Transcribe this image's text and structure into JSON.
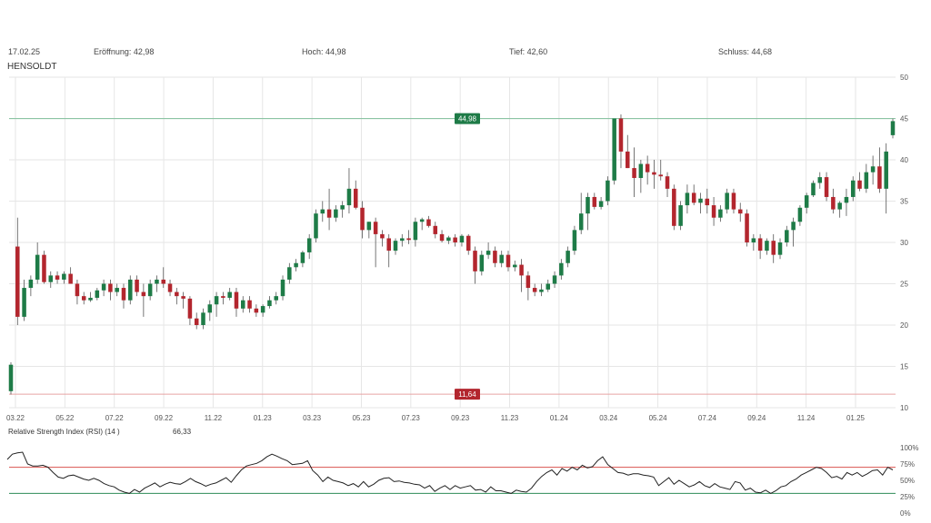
{
  "header": {
    "date": "17.02.25",
    "open_label": "Eröffnung: 42,98",
    "high_label": "Hoch: 44,98",
    "low_label": "Tief: 42,60",
    "close_label": "Schluss: 44,68",
    "symbol": "HENSOLDT"
  },
  "rsi": {
    "label": "Relative Strength Index (RSI) (14 )",
    "current": "66,33"
  },
  "colors": {
    "up": "#1e7b47",
    "down": "#b3262e",
    "grid": "#e6e6e6",
    "rsi_line": "#222222",
    "rsi_upper": "#d9534f",
    "rsi_lower": "#2e8b57"
  },
  "chart_data": [
    {
      "type": "candlestick",
      "title": "HENSOLDT",
      "ylim": [
        10,
        50
      ],
      "y_ticks": [
        "10",
        "15",
        "20",
        "25",
        "30",
        "35",
        "40",
        "45",
        "50"
      ],
      "x_ticks": [
        "03.22",
        "05.22",
        "07.22",
        "09.22",
        "11.22",
        "01.23",
        "03.23",
        "05.23",
        "07.23",
        "09.23",
        "11.23",
        "01.24",
        "03.24",
        "05.24",
        "07.24",
        "09.24",
        "11.24",
        "01.25"
      ],
      "grid": true,
      "max_marker": {
        "label": "44,98",
        "value": 44.98
      },
      "min_marker": {
        "label": "11,64",
        "value": 11.64
      },
      "candles": [
        [
          12,
          15.5,
          11.6,
          15.2
        ],
        [
          29.5,
          33,
          20,
          21
        ],
        [
          21,
          25.5,
          20.5,
          24.5
        ],
        [
          24.5,
          26,
          23.5,
          25.5
        ],
        [
          25.5,
          30,
          25,
          28.5
        ],
        [
          28.5,
          29,
          25,
          25.2
        ],
        [
          25.2,
          26.5,
          24.5,
          26
        ],
        [
          26,
          26.5,
          25,
          25.5
        ],
        [
          25.5,
          26.5,
          25,
          26.2
        ],
        [
          26.2,
          27,
          25,
          25
        ],
        [
          25,
          25.5,
          22.5,
          23.5
        ],
        [
          23.5,
          24,
          22.5,
          23
        ],
        [
          23,
          24,
          22.8,
          23.3
        ],
        [
          23.3,
          24.5,
          23,
          24.2
        ],
        [
          24.2,
          25.5,
          23.5,
          25
        ],
        [
          25,
          25.5,
          23,
          24
        ],
        [
          24,
          25,
          23.5,
          24.5
        ],
        [
          24.5,
          25,
          22,
          23
        ],
        [
          23,
          26,
          22.5,
          25.5
        ],
        [
          25.5,
          26,
          23.5,
          24
        ],
        [
          24,
          25,
          21,
          23.5
        ],
        [
          23.5,
          25.5,
          23,
          25
        ],
        [
          25,
          26,
          24,
          25.5
        ],
        [
          25.5,
          27,
          24.5,
          25
        ],
        [
          25,
          25.5,
          23.5,
          24
        ],
        [
          24,
          24.5,
          22.5,
          23.5
        ],
        [
          23.5,
          24,
          22,
          23.2
        ],
        [
          23.2,
          23.5,
          20,
          20.8
        ],
        [
          20.8,
          21.5,
          19.5,
          20
        ],
        [
          20,
          22,
          19.5,
          21.5
        ],
        [
          21.5,
          23,
          20.5,
          22.5
        ],
        [
          22.5,
          24,
          21,
          23.5
        ],
        [
          23.5,
          24,
          22.5,
          23.3
        ],
        [
          23.3,
          24.5,
          23,
          24
        ],
        [
          24,
          24.5,
          21,
          22
        ],
        [
          22,
          23.5,
          21.5,
          23
        ],
        [
          23,
          23.5,
          21.5,
          22
        ],
        [
          22,
          22.5,
          21,
          21.5
        ],
        [
          21.5,
          22.5,
          21,
          22.3
        ],
        [
          22.3,
          23.5,
          22,
          23
        ],
        [
          23,
          24,
          22.5,
          23.5
        ],
        [
          23.5,
          26,
          23,
          25.5
        ],
        [
          25.5,
          27.5,
          25,
          27
        ],
        [
          27,
          28,
          26.5,
          27.5
        ],
        [
          27.5,
          29,
          27,
          28.8
        ],
        [
          28.8,
          31,
          28,
          30.5
        ],
        [
          30.5,
          34,
          30,
          33.5
        ],
        [
          33.5,
          35,
          32.5,
          34
        ],
        [
          34,
          36.5,
          31.5,
          33
        ],
        [
          33,
          34.5,
          32.5,
          34
        ],
        [
          34,
          35,
          33,
          34.5
        ],
        [
          34.5,
          39,
          33.5,
          36.5
        ],
        [
          36.5,
          37.5,
          34,
          34.2
        ],
        [
          34.2,
          35,
          30.5,
          31.5
        ],
        [
          31.5,
          32.5,
          30.5,
          32.5
        ],
        [
          32.5,
          33,
          27,
          31
        ],
        [
          31,
          31.5,
          29.5,
          30.5
        ],
        [
          30.5,
          31,
          27,
          29
        ],
        [
          29,
          30.5,
          28.5,
          30.2
        ],
        [
          30.2,
          31,
          29.5,
          30.5
        ],
        [
          30.5,
          31.5,
          29.8,
          30.3
        ],
        [
          30.3,
          33,
          29.5,
          32.5
        ],
        [
          32.5,
          33,
          31.5,
          32.8
        ],
        [
          32.8,
          33.2,
          31.8,
          32
        ],
        [
          32,
          32.5,
          30.5,
          31
        ],
        [
          31,
          31.5,
          30,
          30.2
        ],
        [
          30.2,
          30.8,
          29.8,
          30.6
        ],
        [
          30.6,
          31,
          29.5,
          30
        ],
        [
          30,
          31,
          29.5,
          30.8
        ],
        [
          30.8,
          31,
          28.5,
          29
        ],
        [
          29,
          29.5,
          25,
          26.5
        ],
        [
          26.5,
          29,
          26,
          28.5
        ],
        [
          28.5,
          30,
          28,
          29
        ],
        [
          29,
          29.5,
          27,
          27.5
        ],
        [
          27.5,
          29,
          27,
          28.5
        ],
        [
          28.5,
          29,
          26.5,
          27
        ],
        [
          27,
          27.8,
          26.5,
          27.3
        ],
        [
          27.3,
          28,
          24,
          26
        ],
        [
          26,
          26.5,
          23,
          24.5
        ],
        [
          24.5,
          25,
          23.5,
          24
        ],
        [
          24,
          25,
          23.5,
          24.3
        ],
        [
          24.3,
          25.5,
          24,
          25
        ],
        [
          25,
          26.5,
          24.5,
          26
        ],
        [
          26,
          28,
          25.5,
          27.5
        ],
        [
          27.5,
          29.5,
          27,
          29
        ],
        [
          29,
          32,
          28.5,
          31.5
        ],
        [
          31.5,
          36,
          31,
          33.5
        ],
        [
          33.5,
          36,
          31.5,
          35.5
        ],
        [
          35.5,
          36,
          34,
          34.3
        ],
        [
          34.3,
          35.5,
          34,
          35
        ],
        [
          35,
          38,
          34.5,
          37.5
        ],
        [
          37.5,
          45,
          37,
          45
        ],
        [
          45,
          45.5,
          39,
          41
        ],
        [
          41,
          43,
          39,
          39
        ],
        [
          39,
          41.5,
          35.5,
          37.8
        ],
        [
          37.8,
          40,
          36,
          39.5
        ],
        [
          39.5,
          40.5,
          37,
          38.5
        ],
        [
          38.5,
          40,
          36.5,
          38.2
        ],
        [
          38.2,
          40,
          37.5,
          38
        ],
        [
          38,
          38.5,
          35.5,
          36.5
        ],
        [
          36.5,
          37,
          31.5,
          32
        ],
        [
          32,
          35,
          31.5,
          34.5
        ],
        [
          34.5,
          37,
          33.5,
          36
        ],
        [
          36,
          37,
          34.5,
          34.8
        ],
        [
          34.8,
          36,
          33.5,
          35.3
        ],
        [
          35.3,
          36.5,
          33.5,
          34.5
        ],
        [
          34.5,
          35.5,
          32,
          33
        ],
        [
          33,
          34.5,
          32.5,
          34
        ],
        [
          34,
          36.5,
          33.5,
          36
        ],
        [
          36,
          36.5,
          33.5,
          34
        ],
        [
          34,
          34.8,
          32.5,
          33.5
        ],
        [
          33.5,
          34,
          29.5,
          30
        ],
        [
          30,
          31,
          29,
          30.5
        ],
        [
          30.5,
          31,
          28,
          29
        ],
        [
          29,
          30.5,
          28.5,
          30.2
        ],
        [
          30.2,
          31,
          27.5,
          28.5
        ],
        [
          28.5,
          30.5,
          28,
          30
        ],
        [
          30,
          32,
          29.5,
          31.5
        ],
        [
          31.5,
          33,
          29.5,
          32.5
        ],
        [
          32.5,
          34.5,
          32,
          34.2
        ],
        [
          34.2,
          36,
          33.5,
          35.7
        ],
        [
          35.7,
          37.5,
          35.5,
          37.2
        ],
        [
          37.2,
          38.5,
          36.5,
          37.9
        ],
        [
          37.9,
          38.5,
          35,
          35.5
        ],
        [
          35.5,
          36.5,
          33.5,
          34
        ],
        [
          34,
          35,
          33,
          34.8
        ],
        [
          34.8,
          36.5,
          33.2,
          35.5
        ],
        [
          35.5,
          38,
          35,
          37.5
        ],
        [
          37.5,
          38.5,
          36.2,
          36.5
        ],
        [
          36.5,
          39.5,
          36,
          38.5
        ],
        [
          38.5,
          40.5,
          37,
          39.2
        ],
        [
          39.2,
          41.5,
          36,
          36.5
        ],
        [
          36.5,
          42,
          33.5,
          41
        ],
        [
          42.98,
          44.98,
          42.6,
          44.68
        ]
      ]
    },
    {
      "type": "line",
      "title": "Relative Strength Index (RSI) (14 )",
      "ylim": [
        0,
        100
      ],
      "y_ticks": [
        "0%",
        "25%",
        "50%",
        "75%",
        "100%"
      ],
      "thresholds": [
        70,
        30
      ],
      "values": [
        82,
        90,
        92,
        93,
        75,
        72,
        72,
        73,
        70,
        62,
        55,
        53,
        57,
        58,
        55,
        52,
        50,
        53,
        50,
        45,
        42,
        40,
        35,
        32,
        30,
        36,
        32,
        38,
        42,
        46,
        40,
        44,
        47,
        45,
        44,
        48,
        53,
        48,
        45,
        41,
        44,
        46,
        50,
        54,
        47,
        57,
        66,
        72,
        74,
        76,
        80,
        86,
        90,
        87,
        83,
        80,
        74,
        75,
        76,
        80,
        65,
        58,
        48,
        55,
        50,
        48,
        46,
        42,
        45,
        40,
        48,
        40,
        44,
        50,
        53,
        54,
        48,
        49,
        47,
        46,
        44,
        43,
        38,
        42,
        33,
        38,
        42,
        36,
        42,
        38,
        40,
        42,
        35,
        36,
        32,
        40,
        34,
        34,
        32,
        30,
        35,
        33,
        32,
        38,
        48,
        56,
        62,
        66,
        58,
        68,
        64,
        70,
        66,
        73,
        69,
        71,
        80,
        86,
        74,
        68,
        62,
        61,
        58,
        60,
        60,
        58,
        57,
        55,
        42,
        48,
        54,
        44,
        50,
        45,
        40,
        43,
        48,
        42,
        39,
        45,
        40,
        38,
        36,
        48,
        46,
        35,
        38,
        32,
        31,
        35,
        30,
        34,
        40,
        42,
        48,
        52,
        58,
        62,
        66,
        70,
        68,
        62,
        54,
        56,
        52,
        62,
        58,
        62,
        56,
        60,
        65,
        66,
        58,
        70,
        66
      ]
    }
  ]
}
